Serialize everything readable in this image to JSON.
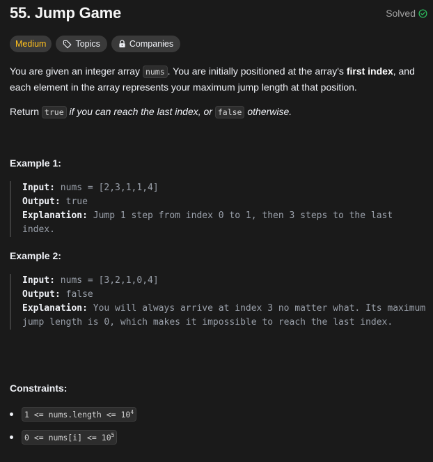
{
  "problem": {
    "title": "55. Jump Game",
    "status": "Solved",
    "difficulty": "Medium",
    "topics_label": "Topics",
    "companies_label": "Companies"
  },
  "description": {
    "p1_a": "You are given an integer array ",
    "p1_code": "nums",
    "p1_b": ". You are initially positioned at the array's ",
    "p1_bold": "first index",
    "p1_c": ", and each element in the array represents your maximum jump length at that position.",
    "p2_a": "Return ",
    "p2_code1": "true",
    "p2_i1": " if you can reach the last index, or ",
    "p2_code2": "false",
    "p2_i2": " otherwise."
  },
  "examples": [
    {
      "heading": "Example 1:",
      "input_label": "Input:",
      "input": " nums = [2,3,1,1,4]",
      "output_label": "Output:",
      "output": " true",
      "explanation_label": "Explanation:",
      "explanation": " Jump 1 step from index 0 to 1, then 3 steps to the last index."
    },
    {
      "heading": "Example 2:",
      "input_label": "Input:",
      "input": " nums = [3,2,1,0,4]",
      "output_label": "Output:",
      "output": " false",
      "explanation_label": "Explanation:",
      "explanation": " You will always arrive at index 3 no matter what. Its maximum jump length is 0, which makes it impossible to reach the last index."
    }
  ],
  "constraints": {
    "heading": "Constraints:",
    "items": [
      {
        "text": "1 <= nums.length <= 10",
        "sup": "4"
      },
      {
        "text": "0 <= nums[i] <= 10",
        "sup": "5"
      }
    ]
  },
  "colors": {
    "background": "#1a1a1a",
    "medium": "#ffc01e",
    "solved_check": "#2cbb5d"
  },
  "icons": {
    "solved": "check-circle-icon",
    "topics": "tag-icon",
    "companies": "lock-icon"
  }
}
